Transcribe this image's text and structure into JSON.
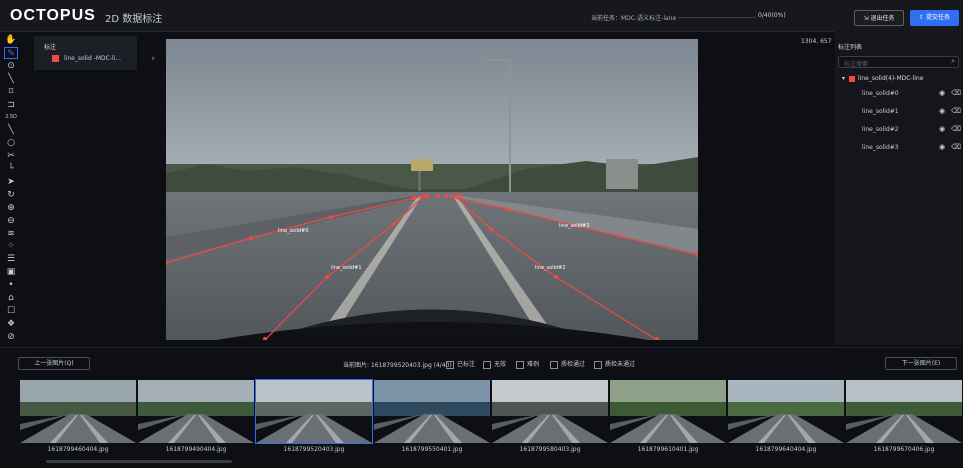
{
  "header": {
    "logo": "OCTOPUS",
    "subtitle": "2D 数据标注",
    "task_label": "当前任务：MDC-语义标注-lane",
    "progress_text": "0/40(0%)",
    "progress_fraction": 0,
    "exit_button": "退出任务",
    "submit_button": "提交任务"
  },
  "toolbar": {
    "tools": [
      {
        "icon": "hand-icon",
        "glyph": "✋"
      },
      {
        "icon": "edit-icon",
        "glyph": "✎",
        "active": true
      },
      {
        "icon": "point-icon",
        "glyph": "⊙"
      },
      {
        "icon": "line-icon",
        "glyph": "╲"
      },
      {
        "icon": "polygon-icon",
        "glyph": "⌑"
      },
      {
        "icon": "polyline-icon",
        "glyph": "⊐"
      },
      {
        "icon": "2-5d-icon",
        "glyph": "2.5D"
      },
      {
        "icon": "slash-icon",
        "glyph": "╲"
      },
      {
        "icon": "circle-icon",
        "glyph": "○"
      },
      {
        "icon": "cut-icon",
        "glyph": "✂"
      },
      {
        "icon": "corner-icon",
        "glyph": "└"
      },
      {
        "icon": "pointer-icon",
        "glyph": "➤"
      },
      {
        "icon": "rotate-icon",
        "glyph": "↻"
      },
      {
        "icon": "zoom-in-icon",
        "glyph": "⊕"
      },
      {
        "icon": "zoom-out-icon",
        "glyph": "⊖"
      },
      {
        "icon": "layers-icon",
        "glyph": "≋"
      },
      {
        "icon": "scatter-icon",
        "glyph": "⁘"
      },
      {
        "icon": "list-icon",
        "glyph": "☰"
      },
      {
        "icon": "image-icon",
        "glyph": "▣"
      },
      {
        "icon": "dot-icon",
        "glyph": "•"
      },
      {
        "icon": "tag-icon",
        "glyph": "⌂"
      },
      {
        "icon": "comment-icon",
        "glyph": "☐"
      },
      {
        "icon": "settings-icon",
        "glyph": "❖"
      },
      {
        "icon": "hide-icon",
        "glyph": "⊘"
      }
    ]
  },
  "label_panel": {
    "title": "标注",
    "current_label": "line_solid -MDC-li...",
    "color": "#f04a41"
  },
  "canvas": {
    "coords": "1304, 657",
    "annotations": [
      "line_solid#0",
      "line_solid#1",
      "line_solid#2",
      "line_solid#3"
    ],
    "line_color": "#f04a41"
  },
  "right_panel": {
    "title": "标注列表",
    "search_placeholder": "标注搜索",
    "group_label": "line_solid(4)-MDC-line",
    "items": [
      "line_solid#0",
      "line_solid#1",
      "line_solid#2",
      "line_solid#3"
    ]
  },
  "nav": {
    "prev_button": "上一张图片(Q)",
    "next_button": "下一张图片(E)",
    "current_image": "当前图片: 1618799520403.jpg (4/40)",
    "checkboxes": [
      "已标注",
      "无效",
      "难例",
      "质检通过",
      "质检未通过"
    ]
  },
  "thumbnails": [
    {
      "name": "1618799460404.jpg"
    },
    {
      "name": "1618799490404.jpg"
    },
    {
      "name": "1618799520403.jpg",
      "selected": true
    },
    {
      "name": "1618799550401.jpg"
    },
    {
      "name": "1618799580403.jpg"
    },
    {
      "name": "1618799610401.jpg"
    },
    {
      "name": "1618799640404.jpg"
    },
    {
      "name": "1618799670406.jpg"
    }
  ]
}
